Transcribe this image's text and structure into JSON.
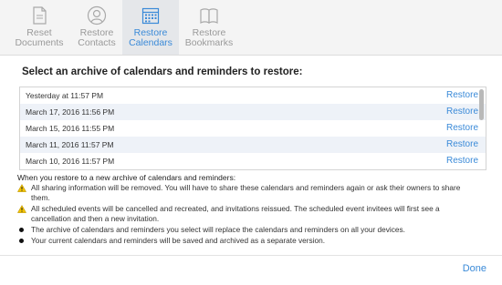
{
  "toolbar": {
    "items": [
      {
        "label": "Reset\nDocuments",
        "icon": "document-icon",
        "active": false
      },
      {
        "label": "Restore\nContacts",
        "icon": "contact-icon",
        "active": false
      },
      {
        "label": "Restore\nCalendars",
        "icon": "calendar-icon",
        "active": true
      },
      {
        "label": "Restore\nBookmarks",
        "icon": "book-icon",
        "active": false
      }
    ]
  },
  "heading": "Select an archive of calendars and reminders to restore:",
  "archives": {
    "restore_label": "Restore",
    "rows": [
      {
        "date": "Yesterday at 11:57 PM"
      },
      {
        "date": "March 17, 2016 11:56 PM"
      },
      {
        "date": "March 15, 2016 11:55 PM"
      },
      {
        "date": "March 11, 2016 11:57 PM"
      },
      {
        "date": "March 10, 2016 11:57 PM"
      }
    ]
  },
  "notes": {
    "title": "When you restore to a new archive of calendars and reminders:",
    "items": [
      {
        "type": "warning",
        "text": "All sharing information will be removed. You will have to share these calendars and reminders again or ask their owners to share them."
      },
      {
        "type": "warning",
        "text": "All scheduled events will be cancelled and recreated, and invitations reissued. The scheduled event invitees will first see a cancellation and then a new invitation."
      },
      {
        "type": "bullet",
        "text": "The archive of calendars and reminders you select will replace the calendars and reminders on all your devices."
      },
      {
        "type": "bullet",
        "text": "Your current calendars and reminders will be saved and archived as a separate version."
      }
    ]
  },
  "footer": {
    "done_label": "Done"
  },
  "colors": {
    "accent": "#3a8ad8",
    "warning": "#f2c200",
    "row_alt": "#eef2f8"
  }
}
